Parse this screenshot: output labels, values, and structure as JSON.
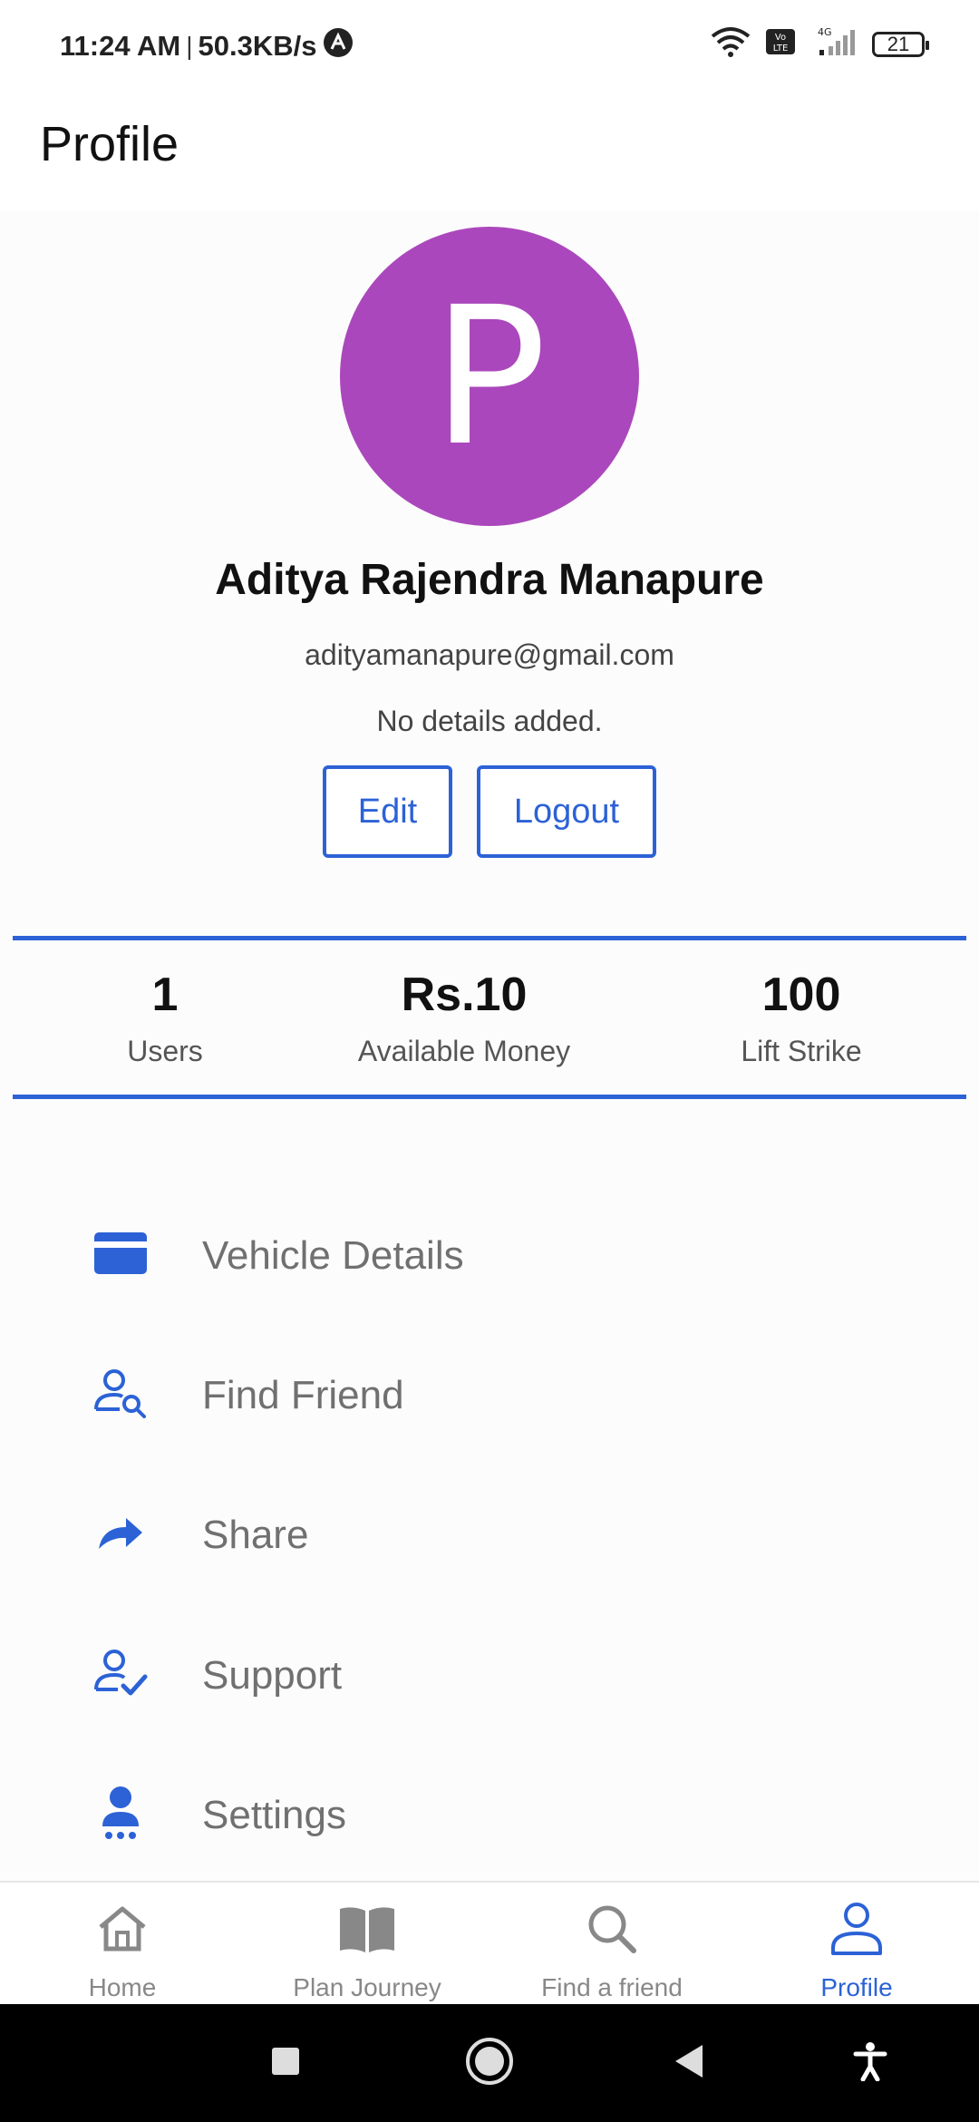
{
  "status_bar": {
    "time": "11:24 AM",
    "separator": "|",
    "speed": "50.3KB/s",
    "network": "4G",
    "volte": "VoLTE",
    "battery": "21"
  },
  "app_bar": {
    "title": "Profile"
  },
  "profile": {
    "avatar_letter": "P",
    "avatar_color": "#ab47bc",
    "name": "Aditya Rajendra Manapure",
    "email": "adityamanapure@gmail.com",
    "details": "No details added.",
    "edit_label": "Edit",
    "logout_label": "Logout"
  },
  "stats": [
    {
      "value": "1",
      "label": "Users"
    },
    {
      "value": "Rs.10",
      "label": "Available Money"
    },
    {
      "value": "100",
      "label": "Lift Strike"
    }
  ],
  "menu": [
    {
      "label": "Vehicle Details",
      "icon": "card-icon"
    },
    {
      "label": "Find Friend",
      "icon": "person-search-icon"
    },
    {
      "label": "Share",
      "icon": "share-arrow-icon"
    },
    {
      "label": "Support",
      "icon": "person-check-icon"
    },
    {
      "label": "Settings",
      "icon": "person-settings-icon"
    }
  ],
  "bottom_nav": [
    {
      "label": "Home",
      "icon": "home-icon",
      "active": false
    },
    {
      "label": "Plan Journey",
      "icon": "book-icon",
      "active": false
    },
    {
      "label": "Find a friend",
      "icon": "search-icon",
      "active": false
    },
    {
      "label": "Profile",
      "icon": "person-icon",
      "active": true
    }
  ],
  "colors": {
    "accent": "#2c62d6",
    "avatar": "#ab47bc",
    "menu_text": "#707070",
    "nav_inactive": "#888888"
  }
}
